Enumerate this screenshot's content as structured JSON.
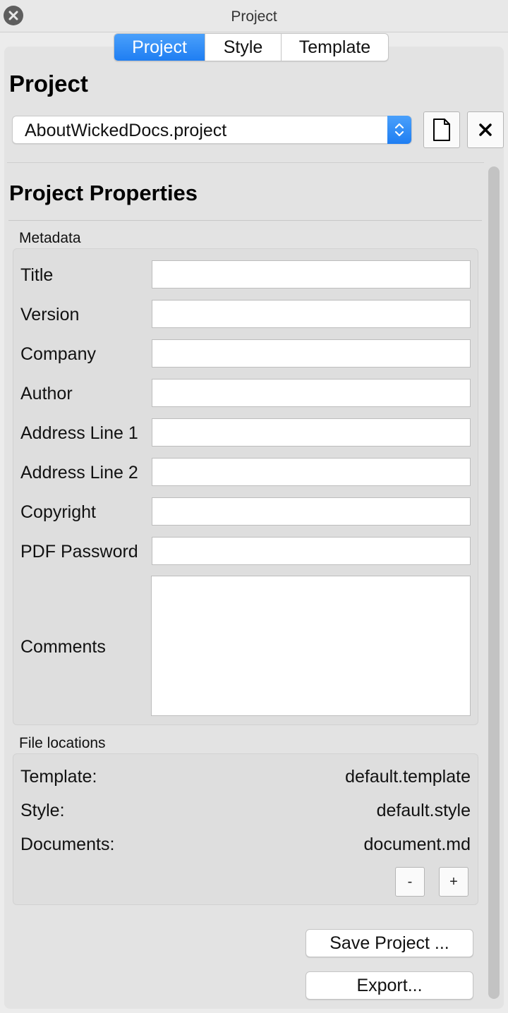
{
  "window": {
    "title": "Project"
  },
  "tabs": [
    {
      "label": "Project",
      "active": true
    },
    {
      "label": "Style",
      "active": false
    },
    {
      "label": "Template",
      "active": false
    }
  ],
  "project": {
    "heading": "Project",
    "selected_file": "AboutWickedDocs.project"
  },
  "properties": {
    "heading": "Project Properties",
    "metadata_label": "Metadata",
    "fields": [
      {
        "label": "Title",
        "value": ""
      },
      {
        "label": "Version",
        "value": ""
      },
      {
        "label": "Company",
        "value": ""
      },
      {
        "label": "Author",
        "value": ""
      },
      {
        "label": "Address Line 1",
        "value": ""
      },
      {
        "label": "Address Line 2",
        "value": ""
      },
      {
        "label": "Copyright",
        "value": ""
      },
      {
        "label": "PDF Password",
        "value": ""
      }
    ],
    "comments_label": "Comments",
    "comments_value": ""
  },
  "file_locations": {
    "label": "File locations",
    "items": [
      {
        "label": "Template:",
        "value": "default.template"
      },
      {
        "label": "Style:",
        "value": "default.style"
      },
      {
        "label": "Documents:",
        "value": "document.md"
      }
    ],
    "remove_label": "-",
    "add_label": "+"
  },
  "actions": {
    "save_label": "Save Project ...",
    "export_label": "Export..."
  },
  "colors": {
    "accent": "#1f7ef2"
  }
}
